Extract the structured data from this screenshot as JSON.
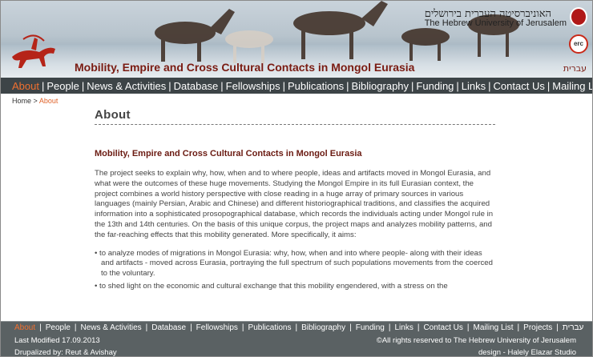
{
  "header": {
    "site_title": "Mobility, Empire and Cross Cultural Contacts in Mongol Eurasia",
    "university_he": "האוניברסיטה העברית בירושלים",
    "university_en": "The Hebrew University of Jerusalem",
    "erc_label": "erc",
    "hebrew_link": "עברית"
  },
  "nav": {
    "items": [
      "About",
      "People",
      "News & Activities",
      "Database",
      "Fellowships",
      "Publications",
      "Bibliography",
      "Funding",
      "Links",
      "Contact Us",
      "Mailing List"
    ],
    "active": "About"
  },
  "breadcrumb": {
    "home": "Home",
    "separator": ">",
    "current": "About"
  },
  "main": {
    "page_title": "About",
    "subtitle": "Mobility, Empire and Cross Cultural Contacts in Mongol Eurasia",
    "intro": "The project seeks to explain why, how, when and to where people, ideas and artifacts moved in Mongol Eurasia, and what were the outcomes of these huge movements. Studying the Mongol Empire in its full Eurasian context, the project combines a world history perspective with close reading in a huge array of primary sources in various languages (mainly Persian, Arabic and Chinese) and different historiographical traditions, and classifies the acquired information into a sophisticated prosopographical database, which records the individuals acting under Mongol rule in the 13th and 14th centuries. On the basis of this unique corpus, the project maps and analyzes mobility patterns, and the far-reaching effects that this mobility generated. More specifically, it aims:",
    "aims": [
      "to analyze modes of migrations in Mongol Eurasia: why, how, when and into where people- along with their ideas and artifacts - moved across Eurasia, portraying the full spectrum of such populations movements from the coerced to the voluntary.",
      "to shed light on the economic and cultural exchange that this mobility engendered, with a stress on the"
    ]
  },
  "footer_nav": {
    "items": [
      "About",
      "People",
      "News & Activities",
      "Database",
      "Fellowships",
      "Publications",
      "Bibliography",
      "Funding",
      "Links",
      "Contact Us",
      "Mailing List",
      "Projects",
      "עברית"
    ],
    "active": "About"
  },
  "footer": {
    "last_modified": "Last Modified 17.09.2013",
    "drupalized": "Drupalized by: Reut & Avishay",
    "rights": "©All rights reserved to The Hebrew University of Jerusalem",
    "design": "design - Halely Elazar Studio"
  },
  "colors": {
    "nav_bg": "#3d4447",
    "active": "#f07030",
    "title_red": "#7a1b12",
    "footer_bg": "#5a6163"
  }
}
